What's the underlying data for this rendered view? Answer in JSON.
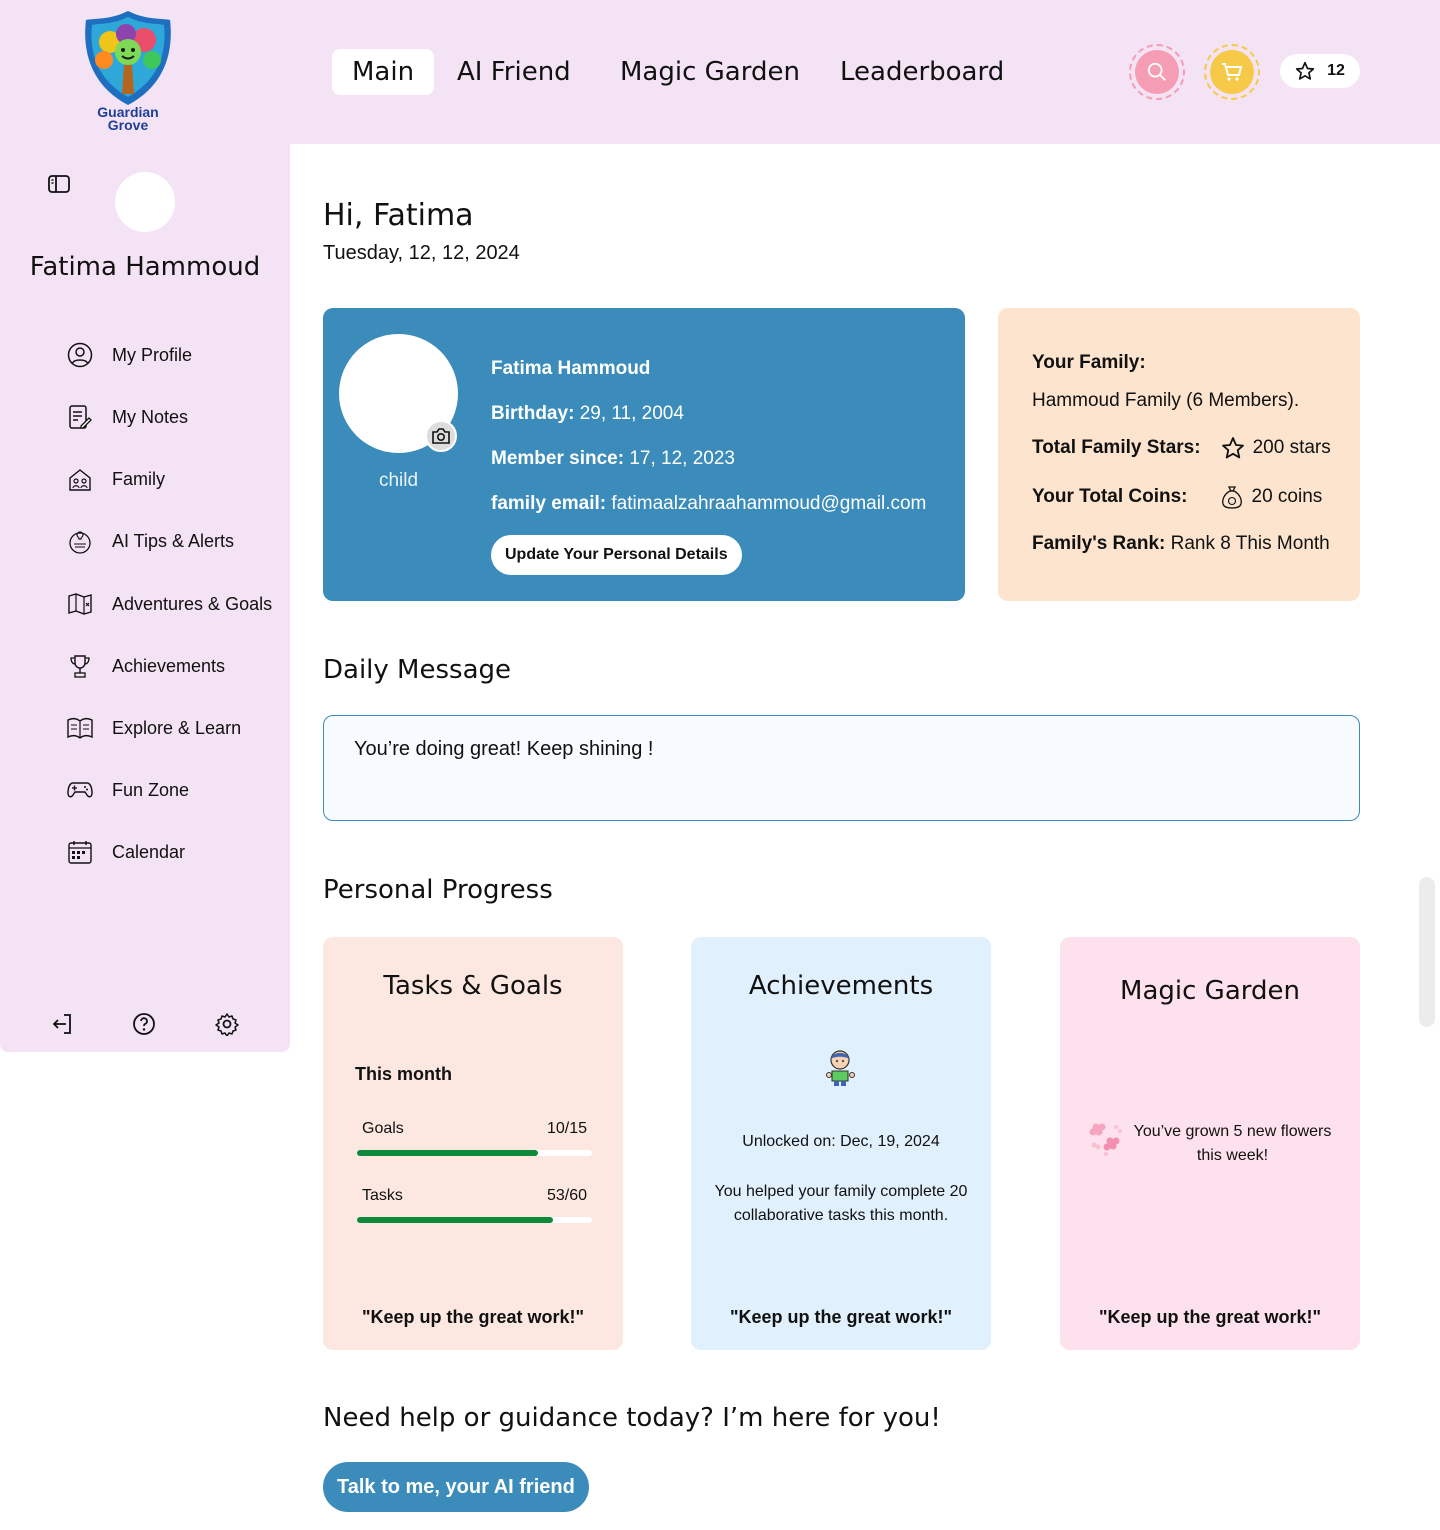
{
  "app": {
    "logo_line1": "Guardian",
    "logo_line2": "Grove"
  },
  "nav": {
    "tabs": [
      "Main",
      "AI Friend",
      "Magic Garden",
      "Leaderboard"
    ],
    "active": "Main"
  },
  "header": {
    "stars_count": "12",
    "search_icon": "search-icon",
    "cart_icon": "cart-icon"
  },
  "sidebar": {
    "user_name": "Fatima Hammoud",
    "items": [
      {
        "label": "My Profile",
        "icon": "user-circle-icon"
      },
      {
        "label": "My Notes",
        "icon": "notes-icon"
      },
      {
        "label": "Family",
        "icon": "family-icon"
      },
      {
        "label": "AI Tips & Alerts",
        "icon": "tips-icon"
      },
      {
        "label": "Adventures & Goals",
        "icon": "map-icon"
      },
      {
        "label": "Achievements",
        "icon": "trophy-icon"
      },
      {
        "label": "Explore & Learn",
        "icon": "book-icon"
      },
      {
        "label": "Fun Zone",
        "icon": "gamepad-icon"
      },
      {
        "label": "Calendar",
        "icon": "calendar-icon"
      }
    ]
  },
  "greeting": {
    "title": "Hi, Fatima",
    "date": "Tuesday, 12, 12, 2024"
  },
  "profile": {
    "role": "child",
    "name": "Fatima Hammoud",
    "birthday_label": "Birthday:",
    "birthday": "29, 11, 2004",
    "member_label": "Member since:",
    "member_since": "17, 12, 2023",
    "email_label": "family email:",
    "email": "fatimaalzahraahammoud@gmail.com",
    "update_button": "Update Your Personal Details"
  },
  "family": {
    "heading": "Your Family:",
    "family_name": "Hammoud Family (6 Members).",
    "stars_label": "Total Family Stars:",
    "stars_value": "200 stars",
    "coins_label": "Your Total Coins:",
    "coins_value": "20 coins",
    "rank_label": "Family's Rank:",
    "rank_value": "Rank 8 This Month"
  },
  "daily": {
    "title": "Daily Message",
    "message": "You’re doing great! Keep shining !"
  },
  "progress": {
    "title": "Personal Progress",
    "tasks_card": {
      "title": "Tasks & Goals",
      "period": "This month",
      "goals_label": "Goals",
      "goals_value": "10/15",
      "goals_fraction": 0.7714,
      "tasks_label": "Tasks",
      "tasks_value": "53/60",
      "tasks_fraction": 0.8357,
      "quote": "\"Keep up the great work!\""
    },
    "achievements_card": {
      "title": "Achievements",
      "unlocked": "Unlocked on: Dec, 19, 2024",
      "description": "You helped your family complete 20 collaborative tasks this month.",
      "quote": "\"Keep up the great work!\""
    },
    "garden_card": {
      "title": "Magic Garden",
      "text": "You’ve grown 5 new flowers this week!",
      "quote": "\"Keep up the great work!\""
    }
  },
  "help": {
    "title": "Need help or guidance today? I’m here for you!",
    "button": "Talk to me, your AI friend"
  },
  "colors": {
    "accent_blue": "#3b8cbb",
    "lavender": "#f3e3f4",
    "peach": "#fde4cf",
    "progress_green": "#0c8a3a"
  }
}
